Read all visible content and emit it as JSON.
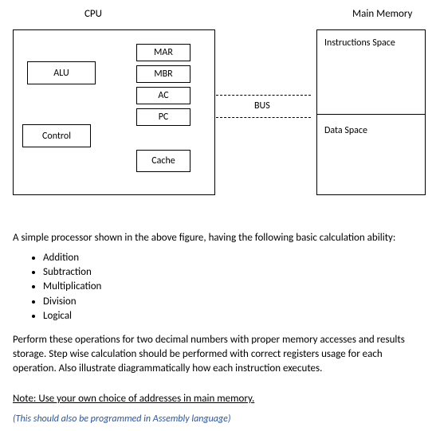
{
  "header": {
    "cpu_label": "CPU",
    "mem_label": "Main Memory"
  },
  "cpu": {
    "alu": "ALU",
    "control": "Control",
    "registers": {
      "mar": "MAR",
      "mbr": "MBR",
      "ac": "AC",
      "pc": "PC"
    },
    "cache": "Cache"
  },
  "bus": {
    "label": "BUS"
  },
  "memory": {
    "instr": "Instructions Space",
    "data": "Data Space"
  },
  "text": {
    "intro": "A simple processor shown in the above figure, having the following basic calculation ability:",
    "ops": [
      "Addition",
      "Subtraction",
      "Multiplication",
      "Division",
      "Logical"
    ],
    "task": "Perform these operations for two decimal numbers with proper memory accesses and results storage. Step wise calculation should be performed with correct registers usage for each operation. Also illustrate diagrammatically how each instruction executes.",
    "note": "Note: Use your own choice of addresses in main memory.",
    "asm": "(This should also be programmed in Assembly language)"
  }
}
